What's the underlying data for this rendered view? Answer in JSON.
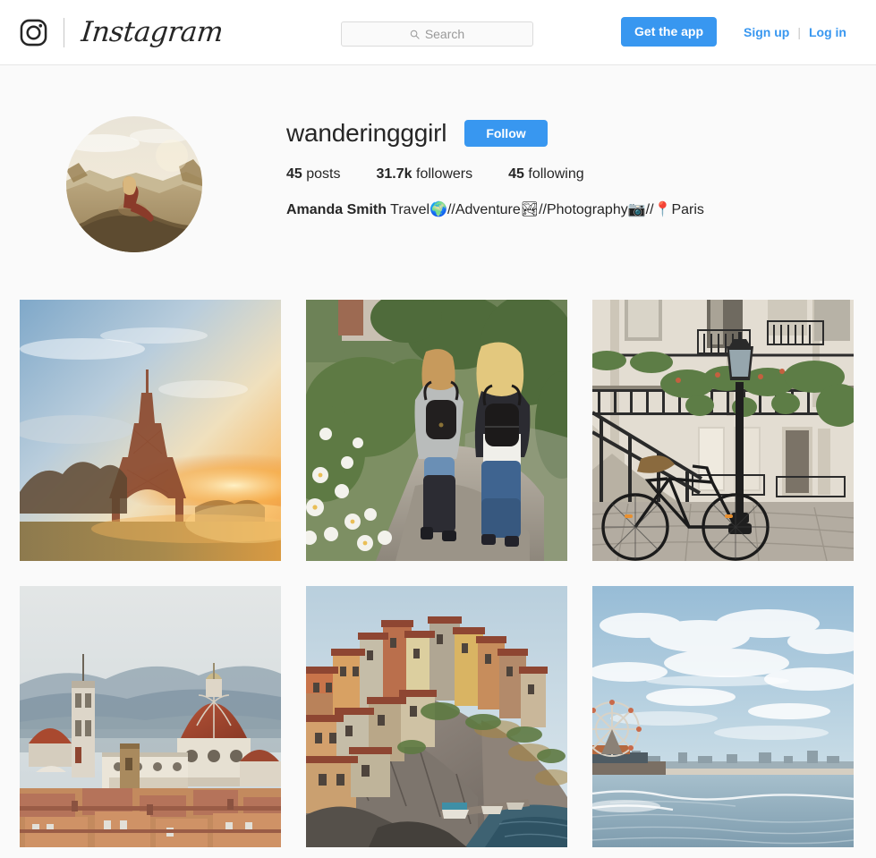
{
  "header": {
    "brand_name": "Instagram",
    "logo_icon": "instagram-camera-icon",
    "search": {
      "placeholder": "Search",
      "value": "",
      "icon": "search-icon"
    },
    "get_app_label": "Get the app",
    "sign_up_label": "Sign up",
    "separator": "|",
    "log_in_label": "Log in"
  },
  "profile": {
    "username": "wanderingggirl",
    "follow_label": "Follow",
    "avatar_alt": "profile-photo",
    "stats": [
      {
        "value": "45",
        "label": "posts"
      },
      {
        "value": "31.7k",
        "label": "followers"
      },
      {
        "value": "45",
        "label": "following"
      }
    ],
    "full_name": "Amanda Smith",
    "bio_parts": [
      {
        "text": " Travel"
      },
      {
        "emoji": "🌍"
      },
      {
        "text": "//Adventure"
      },
      {
        "emoji": "🏞"
      },
      {
        "text": "//Photography"
      },
      {
        "emoji": "📷"
      },
      {
        "text": "// "
      },
      {
        "emoji": "📍"
      },
      {
        "text": "Paris"
      }
    ],
    "bio_text": " Travel🌍//Adventure🏞//Photography📷//📍Paris"
  },
  "grid": {
    "posts": [
      {
        "alt": "eiffel-tower-sunset"
      },
      {
        "alt": "two-women-walking-garden-path"
      },
      {
        "alt": "paris-street-bicycle-lamppost"
      },
      {
        "alt": "florence-duomo-cityscape"
      },
      {
        "alt": "cliffside-village-cinque-terre"
      },
      {
        "alt": "santa-monica-pier-ocean"
      }
    ]
  },
  "colors": {
    "accent_blue": "#3897f0",
    "text_primary": "#262626",
    "page_bg": "#fafafa",
    "border": "#dbdbdb"
  }
}
